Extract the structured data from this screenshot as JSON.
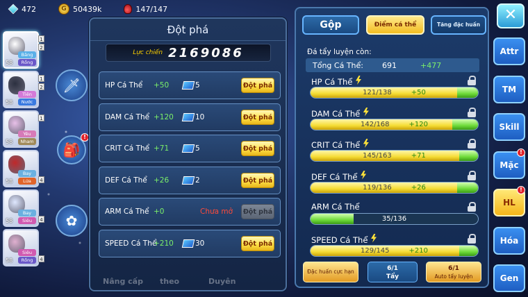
{
  "top": {
    "gems": "472",
    "gold": "50439k",
    "potion": "147/147",
    "gold_glyph": "G"
  },
  "roster": [
    {
      "level": "58",
      "types": [
        "Băng",
        "Rồng"
      ],
      "color": "#ffffff",
      "t1": "#5ab0e8",
      "t2": "#6a58c8",
      "num": "1",
      "num2": "2"
    },
    {
      "level": "58",
      "types": [
        "Tiên",
        "Nước"
      ],
      "color": "#2c3040",
      "t1": "#d37ad8",
      "t2": "#3a7ae0",
      "num": "1",
      "num2": "2"
    },
    {
      "level": "58",
      "types": [
        "Yêu",
        "Nham"
      ],
      "color": "#e8c0e8",
      "t1": "#d67ab8",
      "t2": "#a08a5a",
      "num": "1",
      "num2": ""
    },
    {
      "level": "58",
      "types": [
        "Bay",
        "Lửa"
      ],
      "color": "#c0282a",
      "t1": "#6ab0e0",
      "t2": "#e0642a",
      "num": "",
      "num2": "4"
    },
    {
      "level": "58",
      "types": [
        "Bay",
        "Siêu"
      ],
      "color": "#dfe8ff",
      "t1": "#6ab0e0",
      "t2": "#d05ab0",
      "num": "",
      "num2": "4"
    },
    {
      "level": "58",
      "types": [
        "Siêu",
        "Rồng"
      ],
      "color": "#e0b0d0",
      "t1": "#d05ab0",
      "t2": "#6a58c8",
      "num": "",
      "num2": "4"
    }
  ],
  "left_panel": {
    "title": "Đột phá",
    "power_label": "Lực chiến",
    "power_value": "2169086",
    "rows": [
      {
        "name": "HP Cá Thể",
        "bonus": "+50",
        "qty": "5",
        "button": "Đột phá"
      },
      {
        "name": "DAM Cá Thể",
        "bonus": "+120",
        "qty": "10",
        "button": "Đột phá"
      },
      {
        "name": "CRIT Cá Thể",
        "bonus": "+71",
        "qty": "5",
        "button": "Đột phá"
      },
      {
        "name": "DEF Cá Thể",
        "bonus": "+26",
        "qty": "2",
        "button": "Đột phá"
      },
      {
        "name": "ARM Cá Thể",
        "bonus": "+0",
        "locked": "Chưa mở",
        "button": "Đột phá"
      },
      {
        "name": "SPEED Cá Thể",
        "bonus": "+210",
        "qty": "30",
        "button": "Đột phá"
      }
    ],
    "ghost_labels": [
      "Nâng cấp",
      "theo",
      "Duyên"
    ]
  },
  "right_panel": {
    "tab_merge": "Gộp",
    "tab_points": "Điểm cá thể",
    "tab_special": "Tăng đặc huấn",
    "remain_label": "Đá tẩy luyện còn:",
    "total_label": "Tổng Cá Thể:",
    "total_value": "691",
    "total_bonus": "+477",
    "stats": [
      {
        "name": "HP Cá Thể",
        "value": "121/138",
        "bonus": "+50",
        "base": 121,
        "max": 138,
        "add": 50,
        "bolt": true
      },
      {
        "name": "DAM Cá Thể",
        "value": "142/168",
        "bonus": "+120",
        "base": 142,
        "max": 168,
        "add": 120,
        "bolt": true
      },
      {
        "name": "CRIT Cá Thể",
        "value": "145/163",
        "bonus": "+71",
        "base": 145,
        "max": 163,
        "add": 71,
        "bolt": true
      },
      {
        "name": "DEF Cá Thể",
        "value": "119/136",
        "bonus": "+26",
        "base": 119,
        "max": 136,
        "add": 26,
        "bolt": true
      },
      {
        "name": "ARM Cá Thể",
        "value": "35/136",
        "bonus": "",
        "base": 35,
        "max": 136,
        "add": 0,
        "bolt": false
      },
      {
        "name": "SPEED Cá Thể",
        "value": "129/145",
        "bonus": "+210",
        "base": 129,
        "max": 145,
        "add": 210,
        "bolt": true
      }
    ],
    "btn_special": "Đặc huấn cực hạn",
    "btn_wash_count": "6/1",
    "btn_wash": "Tẩy",
    "btn_auto_count": "6/1",
    "btn_auto": "Auto tẩy luyện"
  },
  "side_tabs": [
    {
      "label": "Attr",
      "badge": false
    },
    {
      "label": "TM",
      "badge": false
    },
    {
      "label": "Skill",
      "badge": false
    },
    {
      "label": "Mặc",
      "badge": true
    },
    {
      "label": "HL",
      "badge": true,
      "active": true
    },
    {
      "label": "Hóa",
      "badge": false
    },
    {
      "label": "Gen",
      "badge": false
    }
  ],
  "close_label": "✕",
  "colors": {
    "accent_yellow": "#f5dc34",
    "accent_green": "#6edb3a",
    "bonus_text": "#7bf06a",
    "locked_text": "#ff4a3a"
  }
}
